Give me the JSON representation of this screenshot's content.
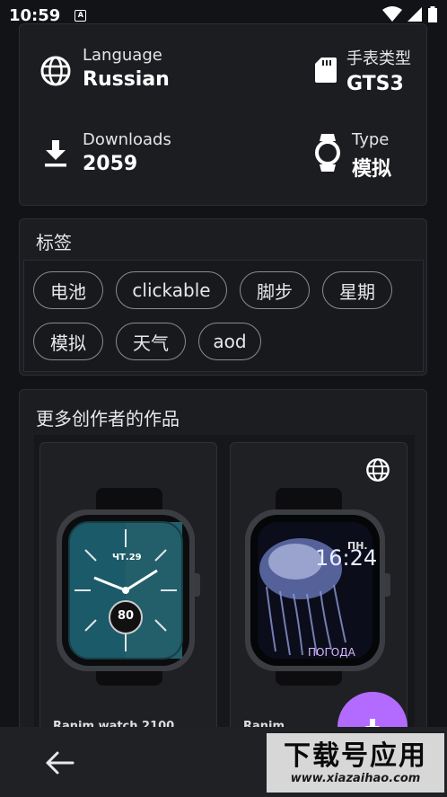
{
  "status_bar": {
    "time": "10:59",
    "notification_letter": "A"
  },
  "info": {
    "language_label": "Language",
    "language_value": "Russian",
    "watch_type_label": "手表类型",
    "watch_type_value": "GTS3",
    "downloads_label": "Downloads",
    "downloads_value": "2059",
    "type_label": "Type",
    "type_value": "模拟"
  },
  "tags": {
    "title": "标签",
    "items": [
      "电池",
      "clickable",
      "脚步",
      "星期",
      "模拟",
      "天气",
      "aod"
    ]
  },
  "more": {
    "title": "更多创作者的作品",
    "cards": [
      {
        "date": "ЧТ.29",
        "value": "80",
        "title": "Ranim watch 2100"
      },
      {
        "day": "ПН.",
        "time": "16:24",
        "weather": "ПОГОДА",
        "title": "Ranim..."
      }
    ]
  },
  "watermark": {
    "main": "下载号应用",
    "sub": "www.xiazaihao.com"
  },
  "colors": {
    "accent": "#b36bff",
    "background": "#121316",
    "card": "#1c1d21"
  }
}
